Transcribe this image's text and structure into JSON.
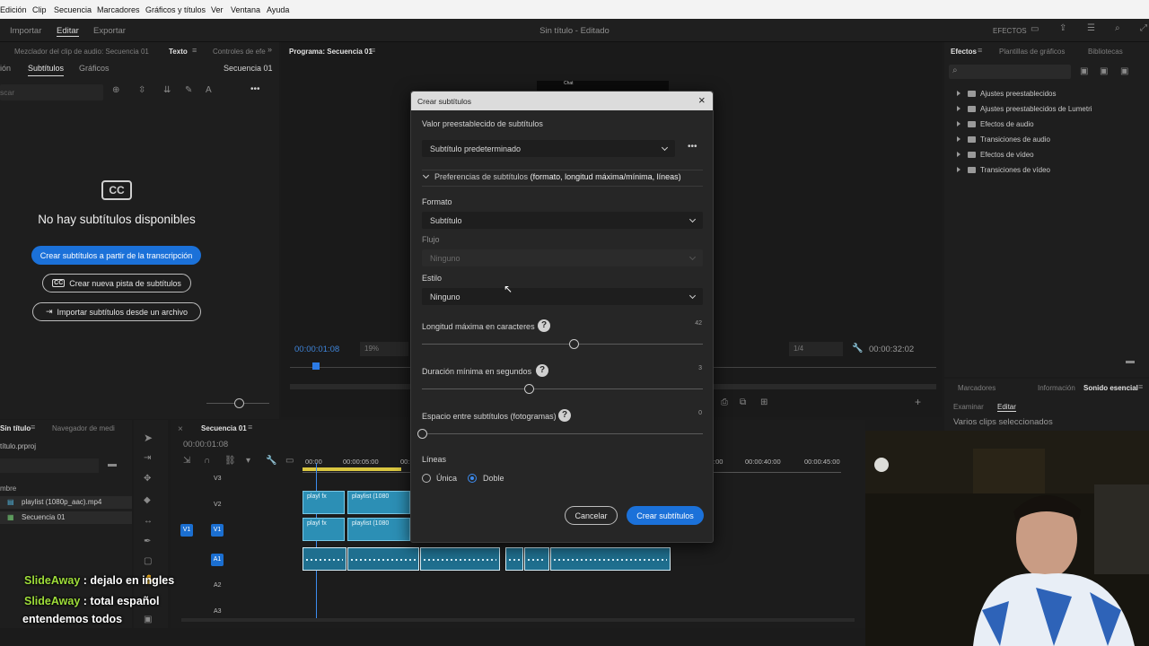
{
  "menu": [
    "Edición",
    "Clip",
    "Secuencia",
    "Marcadores",
    "Gráficos y títulos",
    "Ver",
    "Ventana",
    "Ayuda"
  ],
  "workspace": {
    "tabs": [
      "Importar",
      "Editar",
      "Exportar"
    ],
    "title": "Sin título - Editado",
    "right_label": "EFECTOS"
  },
  "left_panel": {
    "tabs": [
      "Mezclador del clip de audio: Secuencia 01",
      "Texto",
      "Controles de efe"
    ],
    "subtabs": [
      "ión",
      "Subtítulos",
      "Gráficos"
    ],
    "sequence_label": "Secuencia 01",
    "search_placeholder": "scar",
    "cc_badge": "CC",
    "empty_title": "No hay subtítulos disponibles",
    "btn_transcript": "Crear subtítulos a partir de la transcripción",
    "btn_new_track": "Crear nueva pista de subtítulos",
    "btn_import": "Importar subtítulos desde un archivo"
  },
  "program": {
    "title": "Programa: Secuencia 01",
    "timecode_left": "00:00:01:08",
    "zoom": "19%",
    "fraction": "1/4",
    "timecode_right": "00:00:32:02",
    "preview_text": "Chat"
  },
  "right_panel": {
    "tabs": [
      "Efectos",
      "Plantillas de gráficos",
      "Bibliotecas"
    ],
    "items": [
      "Ajustes preestablecidos",
      "Ajustes preestablecidos de Lumetri",
      "Efectos de audio",
      "Transiciones de audio",
      "Efectos de vídeo",
      "Transiciones de vídeo"
    ]
  },
  "essential": {
    "tabs": [
      "Marcadores",
      "Información",
      "Sonido esencial"
    ],
    "subtabs": [
      "Examinar",
      "Editar"
    ],
    "status": "Varios clips seleccionados"
  },
  "project": {
    "tabs": [
      "Sin título",
      "Navegador de medi"
    ],
    "file": "título.prproj",
    "column": "mbre",
    "items": [
      "playlist (1080p_aac).mp4",
      "Secuencia 01"
    ]
  },
  "timeline": {
    "title": "Secuencia 01",
    "timecode": "00:00:01:08",
    "ruler": [
      "00:00",
      "00:00:05:00",
      "00:",
      ":00",
      "00:00:40:00",
      "00:00:45:00"
    ],
    "tracks_video": [
      "V3",
      "V2",
      "V1"
    ],
    "tracks_audio": [
      "A1",
      "A2",
      "A3"
    ],
    "source_v": "V1",
    "clip_labels": [
      "playl",
      "playlist (1080"
    ]
  },
  "dialog": {
    "title": "Crear subtítulos",
    "preset_label": "Valor preestablecido de subtítulos",
    "preset_value": "Subtítulo predeterminado",
    "prefs_label": "Preferencias de subtítulos",
    "prefs_detail": "(formato, longitud máxima/mínima, líneas)",
    "format_label": "Formato",
    "format_value": "Subtítulo",
    "stream_label": "Flujo",
    "stream_value": "Ninguno",
    "style_label": "Estilo",
    "style_value": "Ninguno",
    "max_len_label": "Longitud máxima en caracteres",
    "max_len_value": "42",
    "max_len_fraction": 0.54,
    "min_dur_label": "Duración mínima en segundos",
    "min_dur_value": "3",
    "min_dur_fraction": 0.38,
    "gap_label": "Espacio entre subtítulos (fotogramas)",
    "gap_value": "0",
    "gap_fraction": 0.0,
    "lines_label": "Líneas",
    "line_single": "Única",
    "line_double": "Doble",
    "cancel": "Cancelar",
    "create": "Crear subtítulos"
  },
  "chat": [
    {
      "user": "SlideAway",
      "text": " : dejalo en ingles"
    },
    {
      "user": "SlideAway",
      "text": " : total español"
    },
    {
      "user": "",
      "text": "entendemos todos"
    }
  ]
}
